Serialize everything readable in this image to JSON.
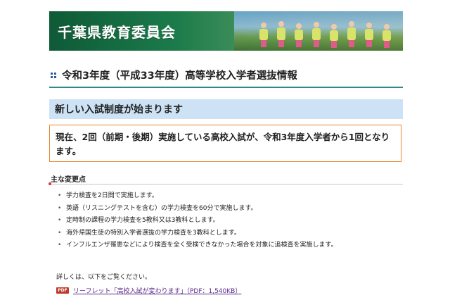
{
  "header": {
    "title": "千葉県教育委員会"
  },
  "page": {
    "title": "令和3年度（平成33年度）高等学校入学者選抜情報"
  },
  "section": {
    "heading": "新しい入試制度が始まります"
  },
  "notice": {
    "text": "現在、2回（前期・後期）実施している高校入試が、令和3年度入学者から1回となります。"
  },
  "points": {
    "heading": "主な変更点",
    "items": [
      "学力検査を2日間で実施します。",
      "英語（リスニングテストを含む）の学力検査を60分で実施します。",
      "定時制の課程の学力検査を5教科又は3教科とします。",
      "海外帰国生徒の特別入学者選抜の学力検査を3教科とします。",
      "インフルエンザ罹患などにより検査を全く受検できなかった場合を対象に追検査を実施します。"
    ]
  },
  "details": {
    "text": "詳しくは、以下をご覧ください。",
    "pdf_badge": "PDF",
    "link_label": "リーフレット「高校入試が変わります」（PDF：1,540KB）"
  },
  "colors": {
    "banner": "#1b7a4a",
    "title_rule": "#2a8c8a",
    "section_bg": "#cde3f5",
    "notice_border": "#e8852e",
    "link": "#5a2a8a"
  }
}
